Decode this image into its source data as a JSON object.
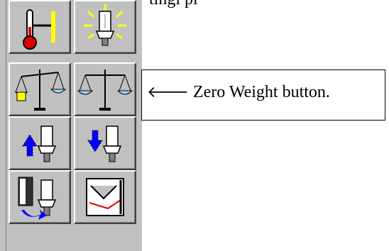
{
  "top_fragment": "tingl       pl",
  "callout": {
    "arrow": "🡐",
    "text": "Zero Weight button."
  },
  "toolbar": {
    "buttons": [
      {
        "icon": "temperature-icon",
        "row": 1,
        "col": 1
      },
      {
        "icon": "lamp-light-icon",
        "row": 1,
        "col": 2
      },
      {
        "icon": "scale-weight-icon",
        "row": 2,
        "col": 1
      },
      {
        "icon": "zero-weight-icon",
        "row": 2,
        "col": 2
      },
      {
        "icon": "lamp-up-icon",
        "row": 3,
        "col": 1
      },
      {
        "icon": "lamp-down-icon",
        "row": 3,
        "col": 2
      },
      {
        "icon": "lamp-exit-icon",
        "row": 4,
        "col": 1
      },
      {
        "icon": "calibrate-icon",
        "row": 4,
        "col": 2
      }
    ]
  },
  "colors": {
    "panel": "#c0c0c0",
    "thermometer": "#ff0000",
    "highlight": "#ffff00",
    "arrow_blue": "#0000ff"
  }
}
